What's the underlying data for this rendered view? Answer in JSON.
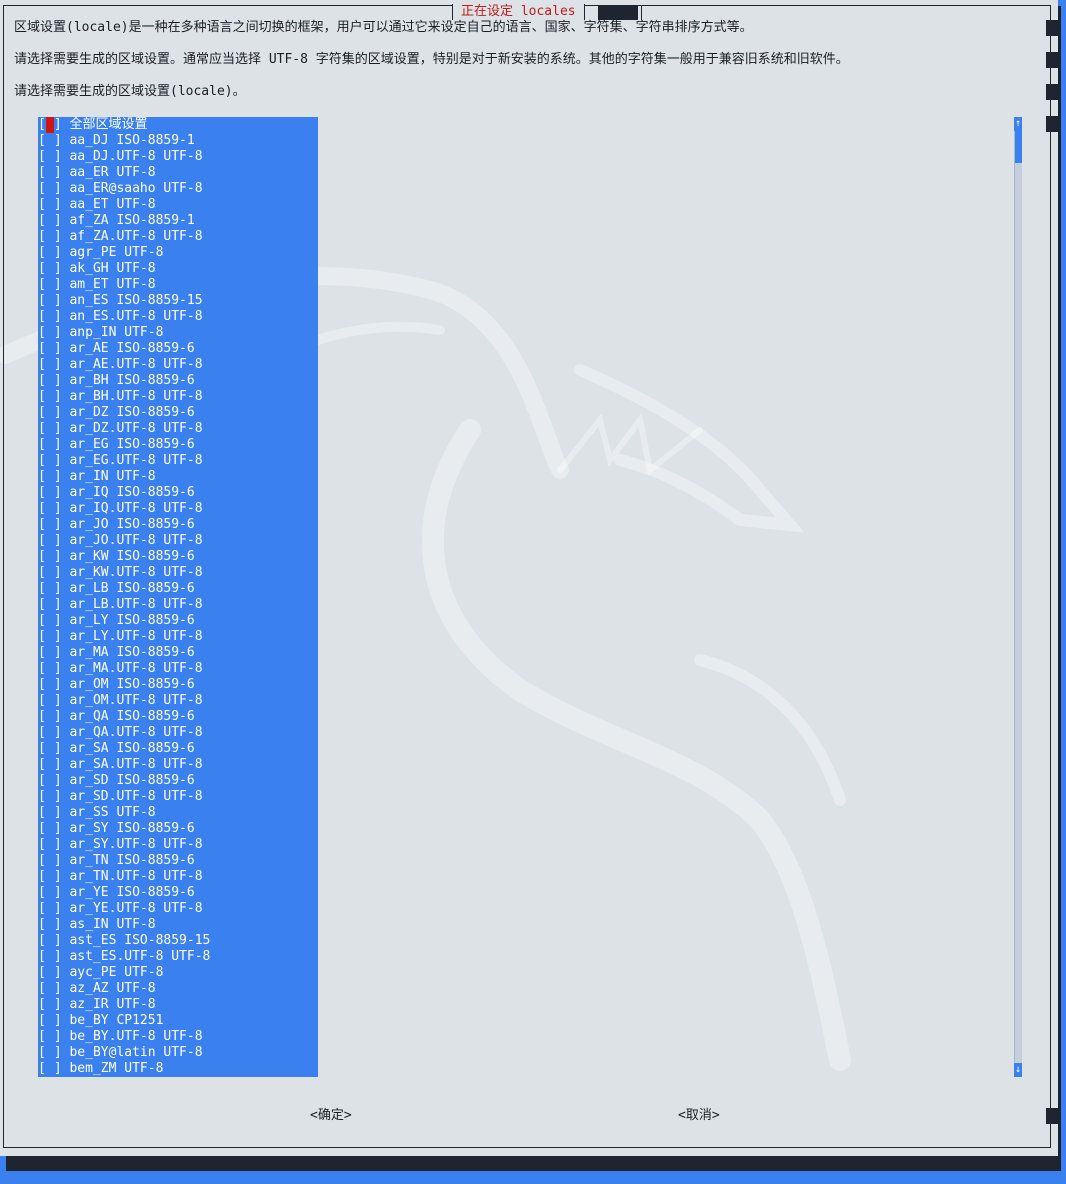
{
  "dialog": {
    "title": "正在设定 locales",
    "description_1": "区域设置(locale)是一种在多种语言之间切换的框架，用户可以通过它来设定自己的语言、国家、字符集、字符串排序方式等。",
    "description_2": "请选择需要生成的区域设置。通常应当选择 UTF-8 字符集的区域设置，特别是对于新安装的系统。其他的字符集一般用于兼容旧系统和旧软件。",
    "description_3": "请选择需要生成的区域设置(locale)。"
  },
  "locale_list": {
    "items": [
      "全部区域设置",
      "aa_DJ ISO-8859-1",
      "aa_DJ.UTF-8 UTF-8",
      "aa_ER UTF-8",
      "aa_ER@saaho UTF-8",
      "aa_ET UTF-8",
      "af_ZA ISO-8859-1",
      "af_ZA.UTF-8 UTF-8",
      "agr_PE UTF-8",
      "ak_GH UTF-8",
      "am_ET UTF-8",
      "an_ES ISO-8859-15",
      "an_ES.UTF-8 UTF-8",
      "anp_IN UTF-8",
      "ar_AE ISO-8859-6",
      "ar_AE.UTF-8 UTF-8",
      "ar_BH ISO-8859-6",
      "ar_BH.UTF-8 UTF-8",
      "ar_DZ ISO-8859-6",
      "ar_DZ.UTF-8 UTF-8",
      "ar_EG ISO-8859-6",
      "ar_EG.UTF-8 UTF-8",
      "ar_IN UTF-8",
      "ar_IQ ISO-8859-6",
      "ar_IQ.UTF-8 UTF-8",
      "ar_JO ISO-8859-6",
      "ar_JO.UTF-8 UTF-8",
      "ar_KW ISO-8859-6",
      "ar_KW.UTF-8 UTF-8",
      "ar_LB ISO-8859-6",
      "ar_LB.UTF-8 UTF-8",
      "ar_LY ISO-8859-6",
      "ar_LY.UTF-8 UTF-8",
      "ar_MA ISO-8859-6",
      "ar_MA.UTF-8 UTF-8",
      "ar_OM ISO-8859-6",
      "ar_OM.UTF-8 UTF-8",
      "ar_QA ISO-8859-6",
      "ar_QA.UTF-8 UTF-8",
      "ar_SA ISO-8859-6",
      "ar_SA.UTF-8 UTF-8",
      "ar_SD ISO-8859-6",
      "ar_SD.UTF-8 UTF-8",
      "ar_SS UTF-8",
      "ar_SY ISO-8859-6",
      "ar_SY.UTF-8 UTF-8",
      "ar_TN ISO-8859-6",
      "ar_TN.UTF-8 UTF-8",
      "ar_YE ISO-8859-6",
      "ar_YE.UTF-8 UTF-8",
      "as_IN UTF-8",
      "ast_ES ISO-8859-15",
      "ast_ES.UTF-8 UTF-8",
      "ayc_PE UTF-8",
      "az_AZ UTF-8",
      "az_IR UTF-8",
      "be_BY CP1251",
      "be_BY.UTF-8 UTF-8",
      "be_BY@latin UTF-8",
      "bem_ZM UTF-8"
    ]
  },
  "scrollbar": {
    "up_arrow": "↑",
    "down_arrow": "↓"
  },
  "buttons": {
    "ok": "<确定>",
    "cancel": "<取消>"
  },
  "colors": {
    "dialog_background": "#dde2e7",
    "list_background": "#3a80ee",
    "title_text": "#c11c1c",
    "cursor": "#d01515"
  },
  "icons": {
    "watermark": "kali-dragon-icon"
  }
}
